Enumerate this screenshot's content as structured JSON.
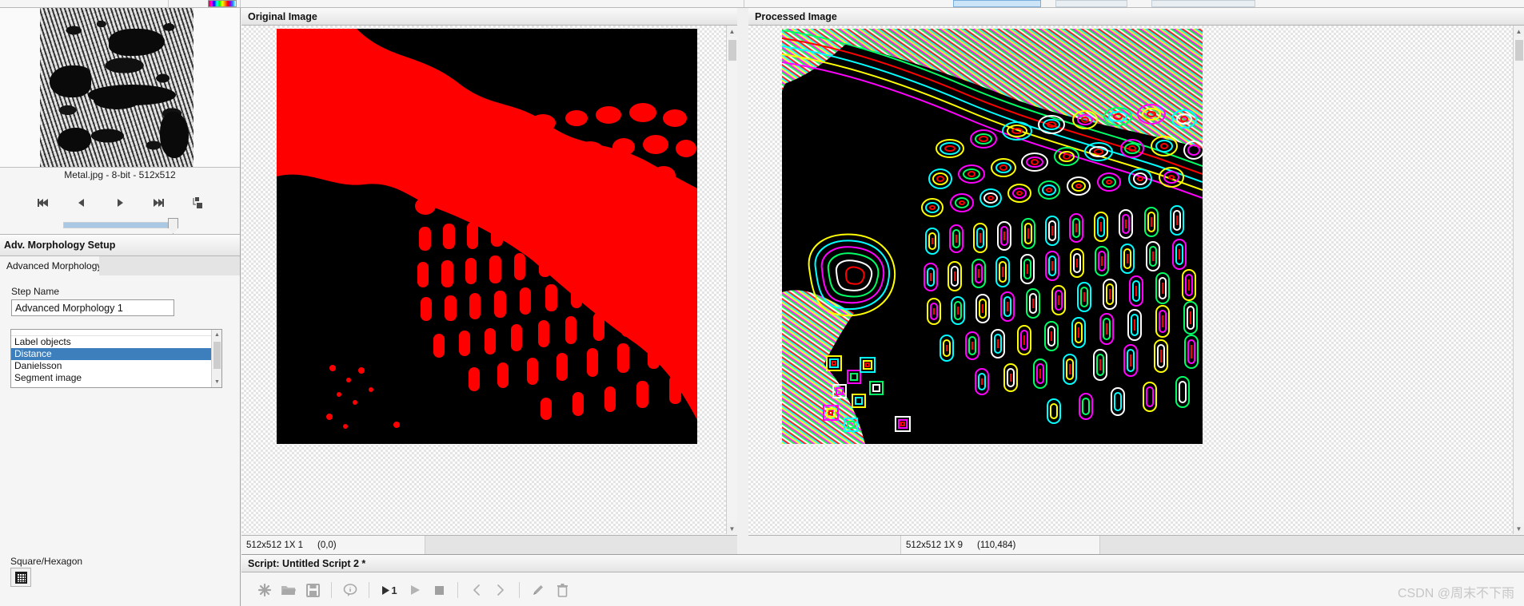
{
  "top_strip": {
    "selected_button_label": "",
    "lut_label": "lut-gradient"
  },
  "left_panel": {
    "thumbnail": {
      "alt": "metal-microstructure-thumbnail"
    },
    "caption": "Metal.jpg - 8-bit - 512x512",
    "nav_buttons": [
      {
        "name": "first-frame-button",
        "icon": "skip-to-start-icon"
      },
      {
        "name": "previous-frame-button",
        "icon": "play-reverse-icon"
      },
      {
        "name": "next-frame-button",
        "icon": "play-icon"
      },
      {
        "name": "last-frame-button",
        "icon": "skip-to-end-icon"
      },
      {
        "name": "layers-button",
        "icon": "layers-icon"
      }
    ],
    "slider": {
      "name": "frame-slider",
      "value": 100
    },
    "setup_title": "Adv. Morphology Setup",
    "tabs": [
      {
        "label": "Advanced Morphology",
        "active": true
      }
    ],
    "step_name_label": "Step Name",
    "step_name_value": "Advanced Morphology 1",
    "operation_list": [
      {
        "label": "Label objects",
        "selected": false
      },
      {
        "label": "Distance",
        "selected": true
      },
      {
        "label": "Danielsson",
        "selected": false
      },
      {
        "label": "Segment image",
        "selected": false
      }
    ],
    "square_hexagon_label": "Square/Hexagon",
    "square_hexagon_button_icon": "grid-icon"
  },
  "original_viewer": {
    "title": "Original Image",
    "status_dimensions": "512x512 1X 1",
    "status_coords": "(0,0)"
  },
  "processed_viewer": {
    "title": "Processed Image",
    "status_dimensions": "512x512 1X 9",
    "status_coords": "(110,484)"
  },
  "script_panel": {
    "title": "Script: Untitled Script 2 *",
    "toolbar": [
      {
        "name": "new-script-button",
        "icon": "asterisk-icon",
        "label": "*",
        "enabled": false
      },
      {
        "name": "open-script-button",
        "icon": "folder-icon",
        "label": "",
        "enabled": false
      },
      {
        "name": "save-script-button",
        "icon": "save-icon",
        "label": "",
        "enabled": false
      },
      {
        "name": "script-info-button",
        "icon": "info-balloon-icon",
        "label": "",
        "enabled": false
      },
      {
        "name": "run-one-step-button",
        "icon": "play-one-icon",
        "label": "1",
        "enabled": true
      },
      {
        "name": "run-script-button",
        "icon": "play-icon",
        "label": "",
        "enabled": false
      },
      {
        "name": "stop-script-button",
        "icon": "stop-icon",
        "label": "",
        "enabled": false
      },
      {
        "name": "step-back-button",
        "icon": "chevron-left-icon",
        "label": "",
        "enabled": false
      },
      {
        "name": "step-forward-button",
        "icon": "chevron-right-icon",
        "label": "",
        "enabled": false
      },
      {
        "name": "edit-script-button",
        "icon": "pencil-icon",
        "label": "",
        "enabled": false
      },
      {
        "name": "delete-step-button",
        "icon": "trash-icon",
        "label": "",
        "enabled": false
      }
    ]
  },
  "watermark": "CSDN @周末不下雨",
  "colors": {
    "accent_selection": "#3c7fbc",
    "overlay_red": "#ff0000",
    "canvas_black": "#000000",
    "panel_bg": "#f5f5f5"
  }
}
